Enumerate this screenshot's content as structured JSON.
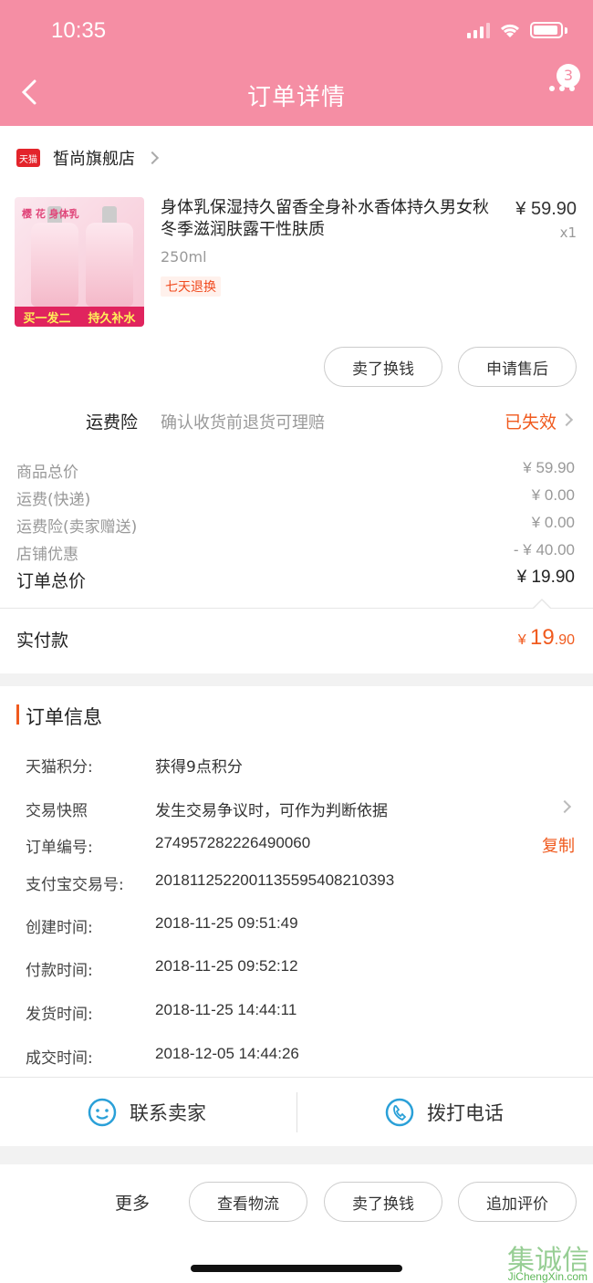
{
  "status_bar": {
    "time": "10:35"
  },
  "header": {
    "title": "订单详情",
    "badge_count": "3"
  },
  "shop": {
    "logo_text": "天猫",
    "name": "皙尚旗舰店"
  },
  "product": {
    "title": "身体乳保湿持久留香全身补水香体持久男女秋冬季滋润肤露干性肤质",
    "spec": "250ml",
    "tag": "七天退换",
    "price": "¥ 59.90",
    "quantity": "x1",
    "thumb_tag": "樱 花 身体乳",
    "thumb_banner_left": "买一发二",
    "thumb_banner_right": "持久补水"
  },
  "product_actions": {
    "sell_label": "卖了换钱",
    "aftersale_label": "申请售后"
  },
  "insurance": {
    "label": "运费险",
    "desc": "确认收货前退货可理赔",
    "status": "已失效"
  },
  "fees": [
    {
      "label": "商品总价",
      "value": "¥ 59.90"
    },
    {
      "label": "运费(快递)",
      "value": "¥ 0.00"
    },
    {
      "label": "运费险(卖家赠送)",
      "value": "¥ 0.00"
    },
    {
      "label": "店铺优惠",
      "value": "- ¥ 40.00"
    }
  ],
  "order_total": {
    "label": "订单总价",
    "value": "¥ 19.90"
  },
  "paid": {
    "label": "实付款",
    "currency": "¥",
    "integer": "19",
    "decimal": ".90"
  },
  "order_info": {
    "title": "订单信息",
    "points": {
      "label": "天猫积分:",
      "value": "获得9点积分"
    },
    "snapshot": {
      "label": "交易快照",
      "value": "发生交易争议时，可作为判断依据"
    },
    "order_no": {
      "label": "订单编号:",
      "value": "274957282226490060",
      "copy": "复制"
    },
    "alipay_no": {
      "label": "支付宝交易号:",
      "value": "2018112522001135595408210393"
    },
    "created": {
      "label": "创建时间:",
      "value": "2018-11-25 09:51:49"
    },
    "paid": {
      "label": "付款时间:",
      "value": "2018-11-25 09:52:12"
    },
    "shipped": {
      "label": "发货时间:",
      "value": "2018-11-25 14:44:11"
    },
    "completed": {
      "label": "成交时间:",
      "value": "2018-12-05 14:44:26"
    }
  },
  "contact": {
    "seller_label": "联系卖家",
    "phone_label": "拨打电话"
  },
  "footer": {
    "more_label": "更多",
    "logistics_label": "查看物流",
    "sell_label": "卖了换钱",
    "review_label": "追加评价"
  },
  "watermark": {
    "brand": "集诚信",
    "url": "JiChengXin.com"
  },
  "colors": {
    "header": "#f58ea4",
    "accent": "#f05a1e",
    "icon_blue": "#2aa0d8"
  }
}
